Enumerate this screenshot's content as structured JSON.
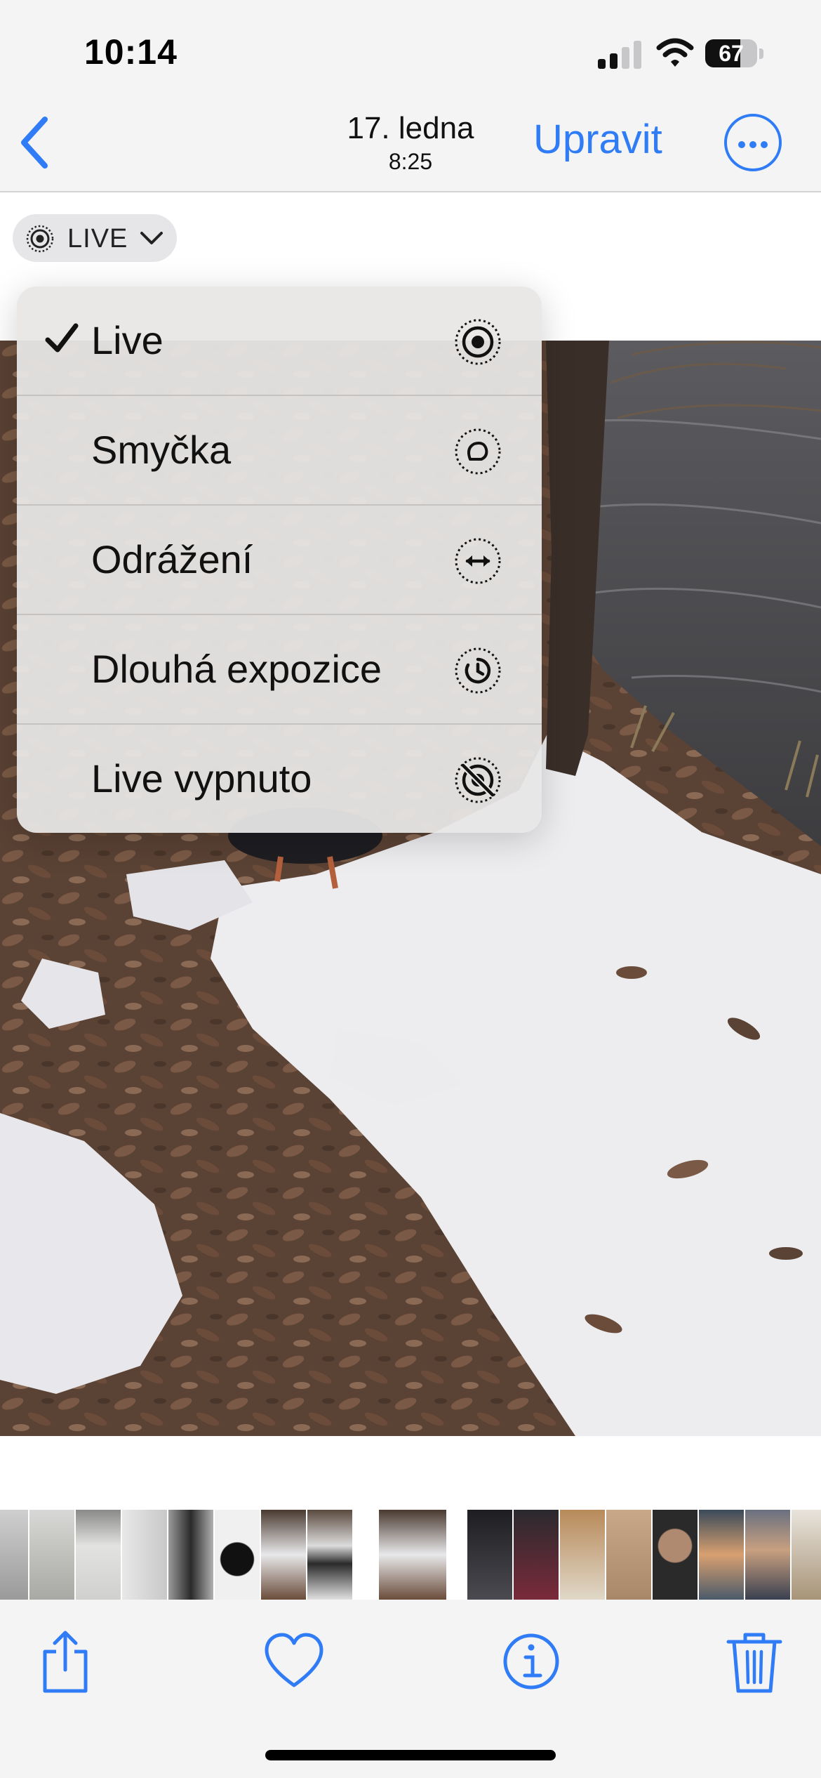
{
  "status_bar": {
    "time": "10:14",
    "battery": "67",
    "battery_level": 0.67
  },
  "nav": {
    "date": "17. ledna",
    "time": "8:25",
    "edit_label": "Upravit"
  },
  "live_badge": {
    "label": "LIVE"
  },
  "menu": {
    "items": [
      {
        "label": "Live",
        "checked": true,
        "icon": "live-icon"
      },
      {
        "label": "Smyčka",
        "checked": false,
        "icon": "loop-icon"
      },
      {
        "label": "Odrážení",
        "checked": false,
        "icon": "bounce-icon"
      },
      {
        "label": "Dlouhá expozice",
        "checked": false,
        "icon": "long-exposure-icon"
      },
      {
        "label": "Live vypnuto",
        "checked": false,
        "icon": "live-off-icon"
      }
    ]
  },
  "toolbar": {
    "icons": [
      "share-icon",
      "heart-icon",
      "info-icon",
      "trash-icon"
    ]
  },
  "colors": {
    "accent": "#2f7cf6",
    "menu_bg": "#e8e7e6",
    "bar_bg": "#f4f4f5"
  }
}
